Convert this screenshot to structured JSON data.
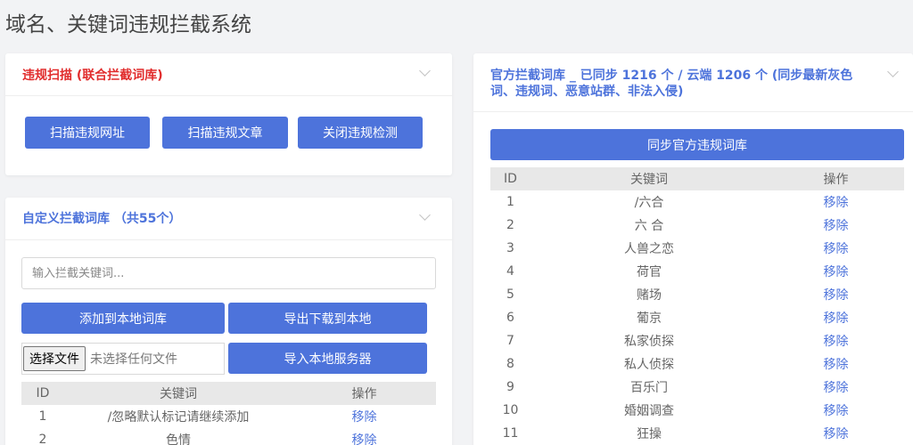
{
  "page": {
    "title": "域名、关键词违规拦截系统"
  },
  "scan": {
    "title": "违规扫描 (联合拦截词库)",
    "buttons": [
      "扫描违规网址",
      "扫描违规文章",
      "关闭违规检测"
    ]
  },
  "custom": {
    "title": "自定义拦截词库 （共55个）",
    "input_placeholder": "输入拦截关键词...",
    "add_label": "添加到本地词库",
    "export_label": "导出下载到本地",
    "file_button": "选择文件",
    "file_status": "未选择任何文件",
    "import_label": "导入本地服务器",
    "columns": [
      "ID",
      "关键词",
      "操作"
    ],
    "rows": [
      {
        "id": "1",
        "keyword": "/忽略默认标记请继续添加",
        "op": "移除"
      },
      {
        "id": "2",
        "keyword": "色情",
        "op": "移除"
      }
    ]
  },
  "official": {
    "title": "官方拦截词库 _ 已同步 1216 个 / 云端 1206 个 (同步最新灰色词、违规词、恶意站群、非法入侵)",
    "sync_label": "同步官方违规词库",
    "columns": [
      "ID",
      "关键词",
      "操作"
    ],
    "rows": [
      {
        "id": "1",
        "keyword": "/六合",
        "op": "移除"
      },
      {
        "id": "2",
        "keyword": "六 合",
        "op": "移除"
      },
      {
        "id": "3",
        "keyword": "人兽之恋",
        "op": "移除"
      },
      {
        "id": "4",
        "keyword": "荷官",
        "op": "移除"
      },
      {
        "id": "5",
        "keyword": "赌场",
        "op": "移除"
      },
      {
        "id": "6",
        "keyword": "葡京",
        "op": "移除"
      },
      {
        "id": "7",
        "keyword": "私家侦探",
        "op": "移除"
      },
      {
        "id": "8",
        "keyword": "私人侦探",
        "op": "移除"
      },
      {
        "id": "9",
        "keyword": "百乐门",
        "op": "移除"
      },
      {
        "id": "10",
        "keyword": "婚姻调查",
        "op": "移除"
      },
      {
        "id": "11",
        "keyword": "狂操",
        "op": "移除"
      }
    ]
  }
}
